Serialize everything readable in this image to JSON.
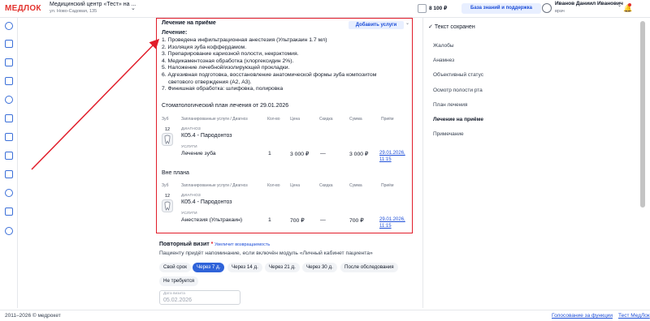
{
  "header": {
    "logo": "МЕДЛОК",
    "clinic_name": "Медицинский центр «Тест» на ...",
    "clinic_address": "ул. Ново-Садовая, 135",
    "balance": "8 100 ₽",
    "kb_button": "База знаний и поддержка",
    "user_name": "Иванов Даниил Иванович",
    "user_role": "врач"
  },
  "sidebar": {
    "icons": [
      "home-icon",
      "calendar-icon",
      "chat-icon",
      "checklist-icon",
      "users-icon",
      "chart-icon",
      "bed-icon",
      "document-icon",
      "box-icon",
      "ruble-icon",
      "puzzle-icon",
      "settings-icon"
    ]
  },
  "treatment": {
    "title": "Лечение на приёме",
    "add_button": "Добавить услуги",
    "heading": "Лечение:",
    "items": [
      "1. Проведена инфильтрационная анестезия (Ультракаин 1.7 мл)",
      "2. Изоляция зуба коффердамом.",
      "3. Препарирование кариозной полости, некрэктомия.",
      "4. Медикаментозная обработка (хлоргексидин 2%).",
      "5. Наложение лечебной/изолирующей прокладки.",
      "6. Адгезивная подготовка, восстановление анатомической формы зуба композитом",
      "    светового отверждения (А2, А3).",
      "7. Финишная обработка: шлифовка, полировка"
    ]
  },
  "plan": {
    "title": "Стоматологический план лечения от 29.01.2026",
    "columns": {
      "tooth": "Зуб",
      "services": "Запланированные услуги / Диагноз",
      "qty": "Кол-во",
      "price": "Цена",
      "discount": "Скидка",
      "sum": "Сумма",
      "visit": "Приём"
    },
    "diag_label": "ДИАГНОЗ",
    "svc_label": "УСЛУГИ",
    "row": {
      "tooth": "12",
      "diagnosis": "К05.4 - Пародонтоз",
      "service": "Лечение зуба",
      "qty": "1",
      "price": "3 000 ₽",
      "discount": "—",
      "sum": "3 000 ₽",
      "visit": "29.01.2026, 11:15"
    }
  },
  "outplan": {
    "title": "Вне плана",
    "row": {
      "tooth": "12",
      "diagnosis": "К05.4 - Пародонтоз",
      "service": "Анестезия (Ультракаин)",
      "qty": "1",
      "price": "700 ₽",
      "discount": "—",
      "sum": "700 ₽",
      "visit": "29.01.2026, 11:15"
    }
  },
  "revisit": {
    "title": "Повторный визит",
    "required_mark": "*",
    "hint": "Увеличит возвращаемость",
    "description": "Пациенту придёт напоминание, если включён модуль «Личный кабинет пациента»",
    "chips": [
      "Свой срок",
      "Через 7 д.",
      "Через 14 д.",
      "Через 21 д.",
      "Через 30 д.",
      "После обследования"
    ],
    "chip_no": "Не требуется",
    "date_label": "Дата визита",
    "date_value": "05.02.2026"
  },
  "right_panel": {
    "saved": "Текст сохранен",
    "items": [
      "Жалобы",
      "Анамнез",
      "Объективный статус",
      "Осмотр полости рта",
      "План лечения",
      "Лечение на приёме",
      "Примечание"
    ],
    "active": "Лечение на приёме"
  },
  "footer": {
    "copyright": "2011–2026 © медрокет",
    "link1": "Голосование за функции",
    "link2": "Тест МедЛок"
  },
  "colors": {
    "accent": "#2f63d9",
    "highlight": "#e11d2a",
    "logo": "#e3342f"
  }
}
